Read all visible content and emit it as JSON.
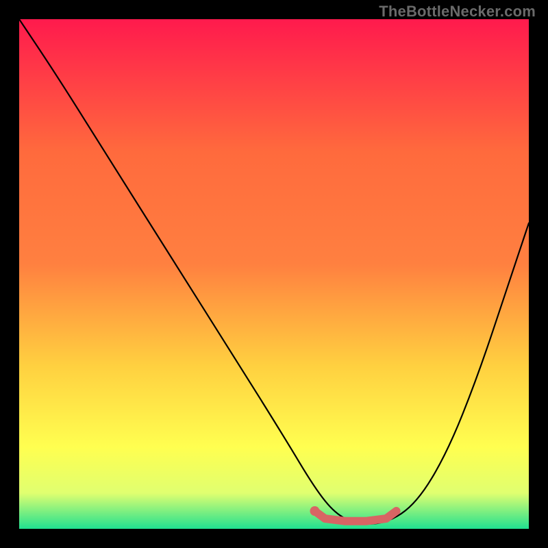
{
  "attribution": "TheBottleNecker.com",
  "chart_data": {
    "type": "line",
    "title": "",
    "xlabel": "",
    "ylabel": "",
    "xlim": [
      0,
      100
    ],
    "ylim": [
      0,
      100
    ],
    "series": [
      {
        "name": "bottleneck-curve",
        "color": "#000000",
        "x": [
          0,
          8,
          18,
          30,
          42,
          52,
          58,
          62,
          66,
          72,
          78,
          84,
          90,
          96,
          100
        ],
        "y": [
          100,
          88,
          72,
          53,
          34,
          18,
          8,
          3,
          1,
          1,
          5,
          15,
          30,
          48,
          60
        ]
      }
    ],
    "highlight": {
      "name": "optimal-range",
      "color": "#d86464",
      "x": [
        58,
        60,
        64,
        68,
        72,
        74
      ],
      "y": [
        3.5,
        2,
        1.5,
        1.5,
        2,
        3.5
      ]
    },
    "background_gradient": {
      "top": "#ff1a4d",
      "mid1": "#ff8040",
      "mid2": "#ffd040",
      "mid3": "#ffff50",
      "mid4": "#e0ff70",
      "bottom": "#20e090"
    }
  }
}
